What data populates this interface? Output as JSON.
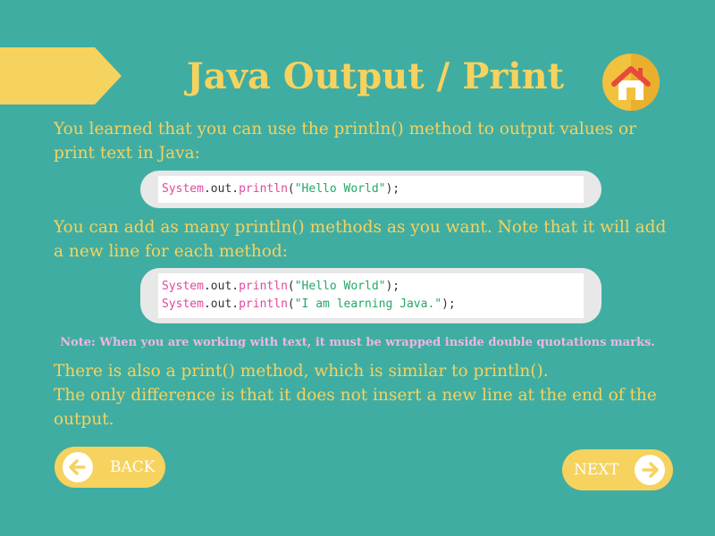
{
  "header": {
    "title": "Java Output / Print",
    "home_icon": "home-icon"
  },
  "content": {
    "intro": "You learned that you can use the println() method to output values or print text in Java:",
    "code1": [
      [
        {
          "t": "System",
          "k": "cls"
        },
        {
          "t": ".",
          "k": "obj"
        },
        {
          "t": "out",
          "k": "obj"
        },
        {
          "t": ".",
          "k": "obj"
        },
        {
          "t": "println",
          "k": "fn"
        },
        {
          "t": "(",
          "k": "obj"
        },
        {
          "t": "\"Hello World\"",
          "k": "str"
        },
        {
          "t": ");",
          "k": "obj"
        }
      ]
    ],
    "multi": "You can add as many println() methods as you want. Note that it will add a new line for each method:",
    "code2": [
      [
        {
          "t": "System",
          "k": "cls"
        },
        {
          "t": ".",
          "k": "obj"
        },
        {
          "t": "out",
          "k": "obj"
        },
        {
          "t": ".",
          "k": "obj"
        },
        {
          "t": "println",
          "k": "fn"
        },
        {
          "t": "(",
          "k": "obj"
        },
        {
          "t": "\"Hello World\"",
          "k": "str"
        },
        {
          "t": ");",
          "k": "obj"
        }
      ],
      [
        {
          "t": "System",
          "k": "cls"
        },
        {
          "t": ".",
          "k": "obj"
        },
        {
          "t": "out",
          "k": "obj"
        },
        {
          "t": ".",
          "k": "obj"
        },
        {
          "t": "println",
          "k": "fn"
        },
        {
          "t": "(",
          "k": "obj"
        },
        {
          "t": "\"I am learning Java.\"",
          "k": "str"
        },
        {
          "t": ");",
          "k": "obj"
        }
      ]
    ],
    "note": "Note: When you are working with text, it must be wrapped inside double quotations marks.",
    "print_line1": "There is also a print() method, which is similar to println().",
    "print_line2": "The only difference is that it does not insert a new line at the end of the output."
  },
  "nav": {
    "back_label": "BACK",
    "next_label": "NEXT",
    "back_icon": "arrow-left-icon",
    "next_icon": "arrow-right-icon"
  },
  "colors": {
    "background": "#40ADA2",
    "accent": "#F6D25E",
    "note": "#EFB6E4",
    "code_keyword": "#E2479E",
    "code_string": "#22A867"
  }
}
